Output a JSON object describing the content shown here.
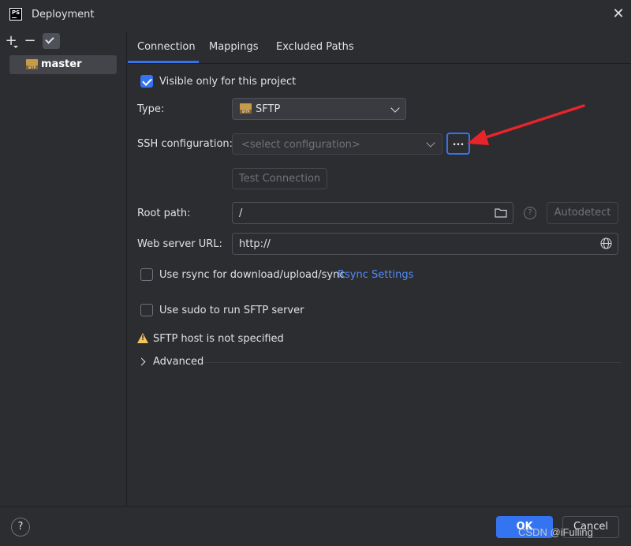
{
  "window": {
    "title": "Deployment",
    "app_icon": "phpstorm-icon",
    "app_icon_text": "PS"
  },
  "toolbar": {
    "add_icon": "plus-icon",
    "remove_icon": "minus-icon",
    "default_icon": "checkmark-icon"
  },
  "servers": [
    {
      "label": "master",
      "icon": "sftp-server-icon"
    }
  ],
  "tabs": [
    {
      "label": "Connection",
      "active": true
    },
    {
      "label": "Mappings",
      "active": false
    },
    {
      "label": "Excluded Paths",
      "active": false
    }
  ],
  "form": {
    "visible_only": {
      "label": "Visible only for this project",
      "checked": true
    },
    "type": {
      "label": "Type:",
      "value": "SFTP"
    },
    "ssh": {
      "label": "SSH configuration:",
      "placeholder": "<select configuration>",
      "browse_label": "..."
    },
    "test_connection": "Test Connection",
    "root_path": {
      "label": "Root path:",
      "value": "/",
      "autodetect": "Autodetect",
      "help": "?"
    },
    "web_server_url": {
      "label": "Web server URL:",
      "value": "http://"
    },
    "rsync": {
      "label": "Use rsync for download/upload/sync",
      "link": "Rsync Settings",
      "checked": false
    },
    "sudo": {
      "label": "Use sudo to run SFTP server",
      "checked": false
    },
    "warning": "SFTP host is not specified",
    "advanced": "Advanced"
  },
  "footer": {
    "help": "?",
    "ok": "OK",
    "cancel": "Cancel"
  },
  "watermark": "CSDN @iFulling",
  "colors": {
    "accent": "#3574f0",
    "background": "#2b2d30",
    "annotation_arrow": "#e8242b",
    "warning": "#f2c55c"
  }
}
